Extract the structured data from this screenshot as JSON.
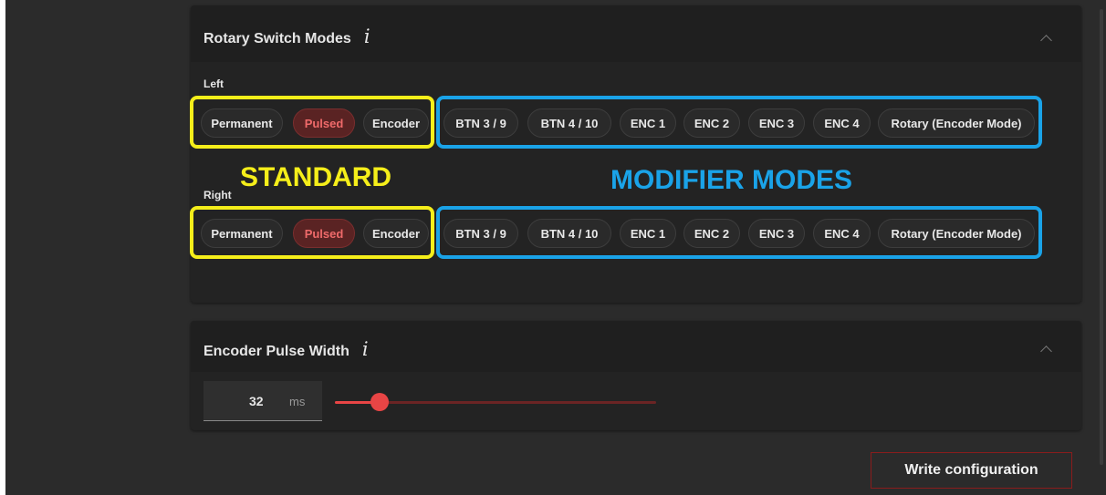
{
  "rotary_panel": {
    "title": "Rotary Switch Modes",
    "info_icon": "i",
    "left_label": "Left",
    "right_label": "Right",
    "left_buttons": [
      "Permanent",
      "Pulsed",
      "Encoder",
      "BTN 3 / 9",
      "BTN 4 / 10",
      "ENC 1",
      "ENC 2",
      "ENC 3",
      "ENC 4",
      "Rotary (Encoder Mode)"
    ],
    "right_buttons": [
      "Permanent",
      "Pulsed",
      "Encoder",
      "BTN 3 / 9",
      "BTN 4 / 10",
      "ENC 1",
      "ENC 2",
      "ENC 3",
      "ENC 4",
      "Rotary (Encoder Mode)"
    ],
    "left_selected": "Pulsed",
    "right_selected": "Pulsed"
  },
  "annotations": {
    "standard": "STANDARD",
    "modifier": "MODIFIER MODES"
  },
  "pulse_panel": {
    "title": "Encoder Pulse Width",
    "info_icon": "i",
    "value": "32",
    "unit": "ms",
    "slider_fraction": 0.14
  },
  "footer": {
    "write_label": "Write configuration"
  },
  "colors": {
    "accent": "#e84545",
    "selected_text": "#ef6a6a",
    "annotation_yellow": "#f5ee1a",
    "annotation_blue": "#1aa3e8",
    "write_border": "#8a1c1c"
  },
  "icons": [
    "info-icon",
    "chevron-up-icon",
    "slider-thumb"
  ]
}
